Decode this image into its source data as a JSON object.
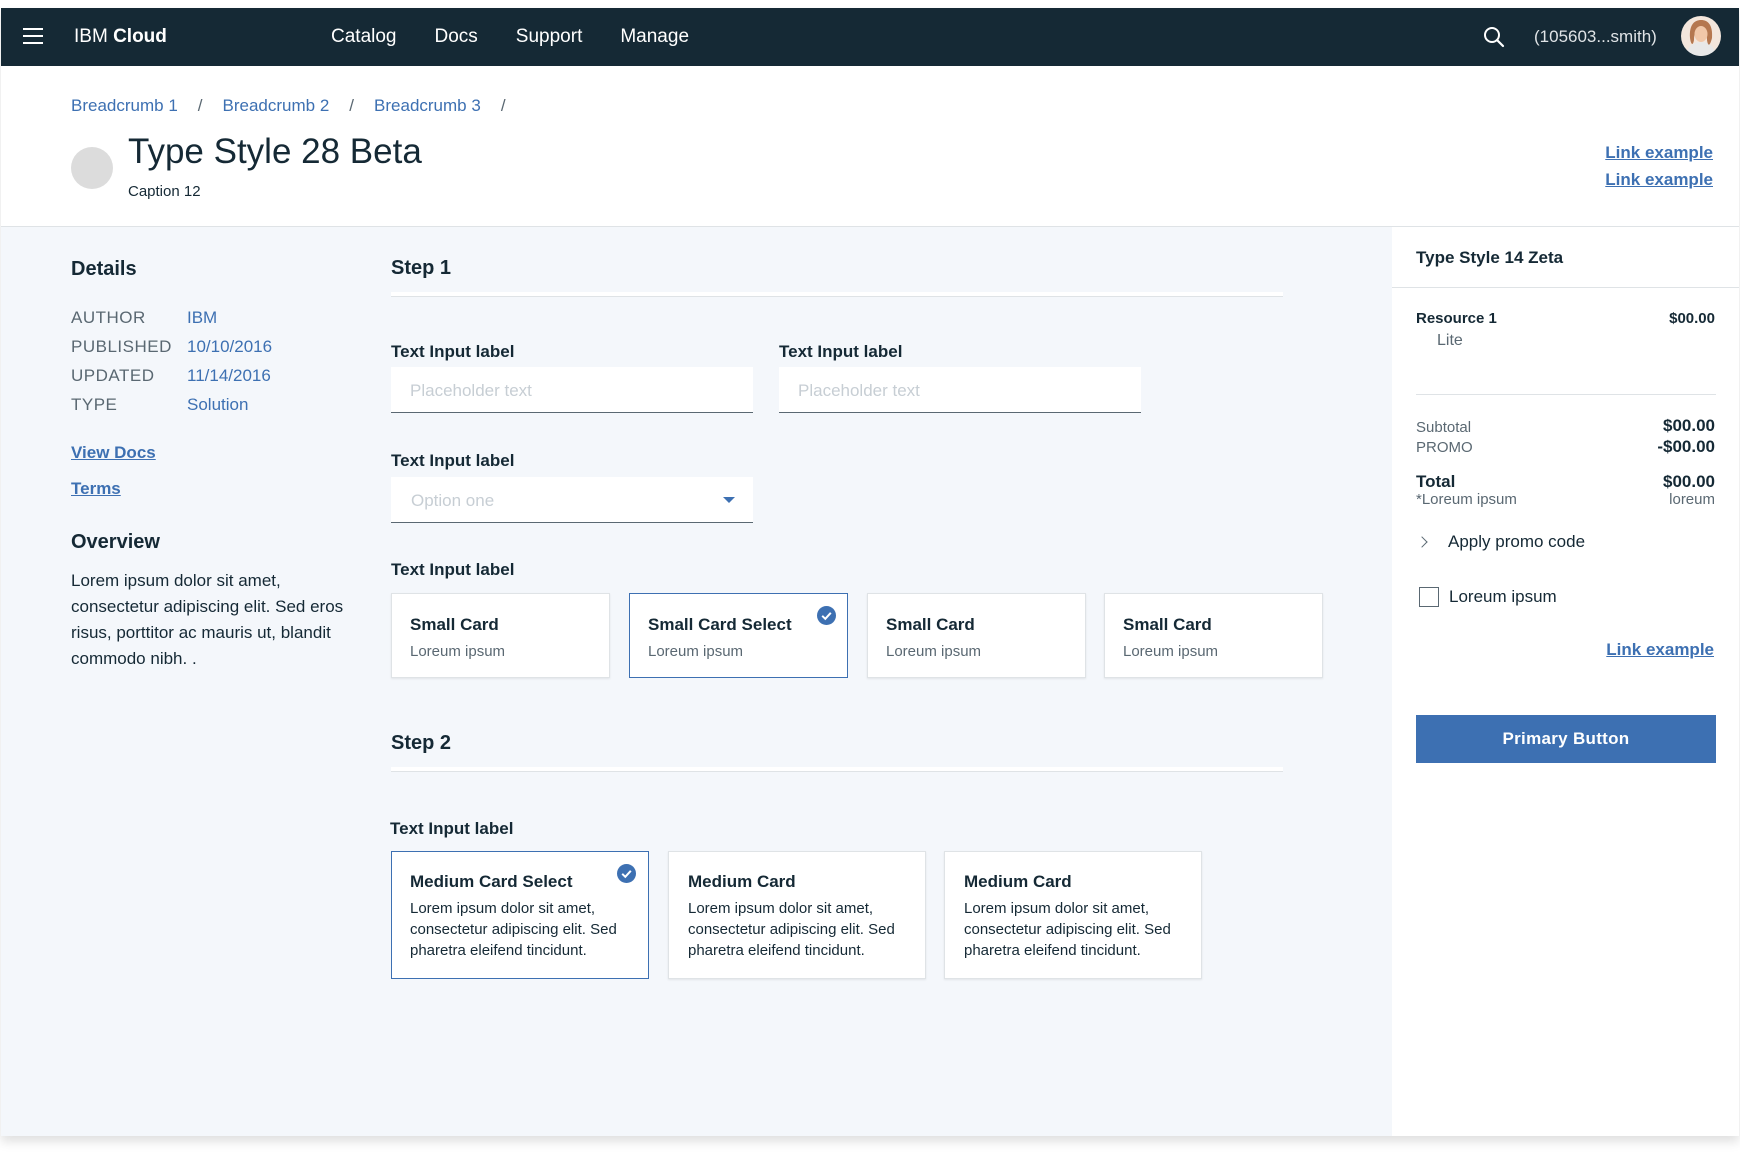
{
  "topbar": {
    "brand_prefix": "IBM",
    "brand_name": "Cloud",
    "nav": [
      "Catalog",
      "Docs",
      "Support",
      "Manage"
    ],
    "user": "(105603...smith)"
  },
  "header": {
    "breadcrumbs": [
      "Breadcrumb 1",
      "Breadcrumb 2",
      "Breadcrumb 3"
    ],
    "separator": "/",
    "title": "Type Style 28 Beta",
    "caption": "Caption 12",
    "links": [
      "Link example",
      "Link example"
    ]
  },
  "details": {
    "heading": "Details",
    "rows": [
      {
        "key": "AUTHOR",
        "value": "IBM"
      },
      {
        "key": "PUBLISHED",
        "value": "10/10/2016"
      },
      {
        "key": "UPDATED",
        "value": "11/14/2016"
      },
      {
        "key": "TYPE",
        "value": "Solution"
      }
    ],
    "links": [
      "View Docs",
      "Terms"
    ],
    "overview_heading": "Overview",
    "overview_text": "Lorem ipsum dolor sit amet, consectetur adipiscing elit. Sed eros risus, porttitor ac mauris ut, blandit commodo nibh. ."
  },
  "step1": {
    "title": "Step 1",
    "input1": {
      "label": "Text Input label",
      "placeholder": "Placeholder text"
    },
    "input2": {
      "label": "Text Input label",
      "placeholder": "Placeholder text"
    },
    "select": {
      "label": "Text Input label",
      "value": "Option one"
    },
    "cards_label": "Text Input label",
    "cards": [
      {
        "title": "Small Card",
        "sub": "Loreum ipsum",
        "selected": false
      },
      {
        "title": "Small Card Select",
        "sub": "Loreum ipsum",
        "selected": true
      },
      {
        "title": "Small Card",
        "sub": "Loreum ipsum",
        "selected": false
      },
      {
        "title": "Small Card",
        "sub": "Loreum ipsum",
        "selected": false
      }
    ]
  },
  "step2": {
    "title": "Step 2",
    "cards_label": "Text Input label",
    "cards": [
      {
        "title": "Medium Card Select",
        "body": "Lorem ipsum dolor sit amet, consectetur adipiscing elit. Sed pharetra eleifend tincidunt.",
        "selected": true
      },
      {
        "title": "Medium Card",
        "body": "Lorem ipsum dolor sit amet, consectetur adipiscing elit. Sed pharetra eleifend tincidunt.",
        "selected": false
      },
      {
        "title": "Medium Card",
        "body": "Lorem ipsum dolor sit amet, consectetur adipiscing elit. Sed pharetra eleifend tincidunt.",
        "selected": false
      }
    ]
  },
  "panel": {
    "heading": "Type Style 14 Zeta",
    "resource": {
      "name": "Resource 1",
      "price": "$00.00",
      "plan": "Lite"
    },
    "subtotal_label": "Subtotal",
    "subtotal_value": "$00.00",
    "promo_label": "PROMO",
    "promo_value": "-$00.00",
    "total_label": "Total",
    "total_value": "$00.00",
    "total_note": "*Loreum ipsum",
    "total_note_right": "loreum",
    "apply_promo": "Apply promo code",
    "checkbox_label": "Loreum ipsum",
    "link": "Link example",
    "primary_button": "Primary  Button"
  },
  "colors": {
    "topbar": "#152935",
    "accent": "#3d70b2",
    "background": "#f4f7fb"
  }
}
